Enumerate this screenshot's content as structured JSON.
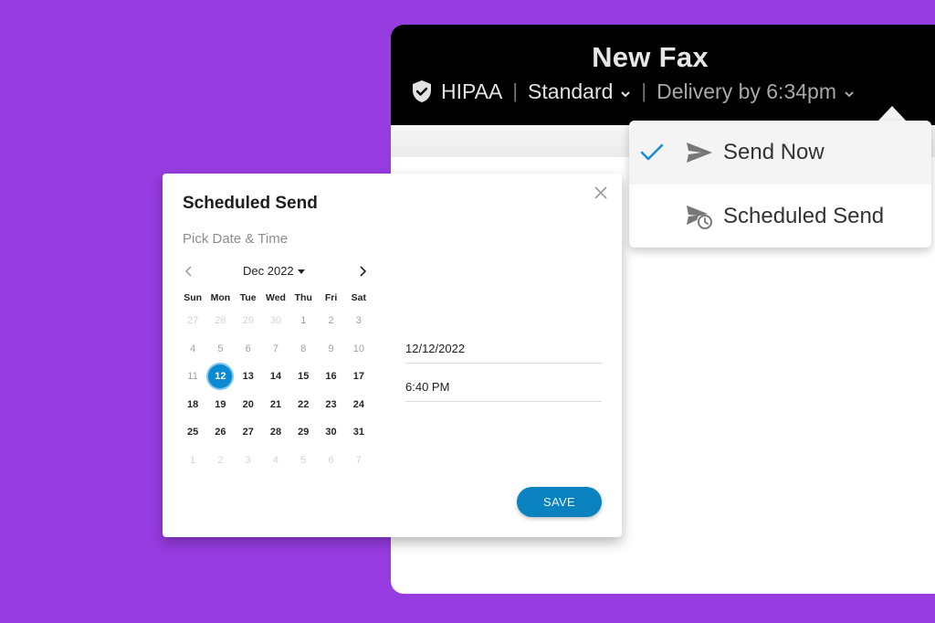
{
  "fax_window": {
    "title": "New Fax",
    "security_label": "HIPAA",
    "security_icon": "shield-check-icon",
    "quality_label": "Standard",
    "delivery_label": "Delivery by 6:34pm",
    "separator": "|"
  },
  "send_menu": {
    "items": [
      {
        "label": "Send Now",
        "icon": "paper-plane-icon",
        "checked": true
      },
      {
        "label": "Scheduled Send",
        "icon": "scheduled-send-icon",
        "checked": false
      }
    ]
  },
  "modal": {
    "title": "Scheduled Send",
    "subtitle": "Pick Date & Time",
    "date_value": "12/12/2022",
    "time_value": "6:40 PM",
    "save_label": "SAVE"
  },
  "calendar": {
    "month_label": "Dec 2022",
    "weekdays": [
      "Sun",
      "Mon",
      "Tue",
      "Wed",
      "Thu",
      "Fri",
      "Sat"
    ],
    "weeks": [
      [
        {
          "d": "27",
          "s": "other"
        },
        {
          "d": "28",
          "s": "other"
        },
        {
          "d": "29",
          "s": "other"
        },
        {
          "d": "30",
          "s": "other"
        },
        {
          "d": "1",
          "s": "past"
        },
        {
          "d": "2",
          "s": "past"
        },
        {
          "d": "3",
          "s": "past"
        }
      ],
      [
        {
          "d": "4",
          "s": "past"
        },
        {
          "d": "5",
          "s": "past"
        },
        {
          "d": "6",
          "s": "past"
        },
        {
          "d": "7",
          "s": "past"
        },
        {
          "d": "8",
          "s": "past"
        },
        {
          "d": "9",
          "s": "past"
        },
        {
          "d": "10",
          "s": "past"
        }
      ],
      [
        {
          "d": "11",
          "s": "past"
        },
        {
          "d": "12",
          "s": "selected"
        },
        {
          "d": "13",
          "s": "cur"
        },
        {
          "d": "14",
          "s": "cur"
        },
        {
          "d": "15",
          "s": "cur"
        },
        {
          "d": "16",
          "s": "cur"
        },
        {
          "d": "17",
          "s": "cur"
        }
      ],
      [
        {
          "d": "18",
          "s": "cur"
        },
        {
          "d": "19",
          "s": "cur"
        },
        {
          "d": "20",
          "s": "cur"
        },
        {
          "d": "21",
          "s": "cur"
        },
        {
          "d": "22",
          "s": "cur"
        },
        {
          "d": "23",
          "s": "cur"
        },
        {
          "d": "24",
          "s": "cur"
        }
      ],
      [
        {
          "d": "25",
          "s": "cur"
        },
        {
          "d": "26",
          "s": "cur"
        },
        {
          "d": "27",
          "s": "cur"
        },
        {
          "d": "28",
          "s": "cur"
        },
        {
          "d": "29",
          "s": "cur"
        },
        {
          "d": "30",
          "s": "cur"
        },
        {
          "d": "31",
          "s": "cur"
        }
      ],
      [
        {
          "d": "1",
          "s": "other"
        },
        {
          "d": "2",
          "s": "other"
        },
        {
          "d": "3",
          "s": "other"
        },
        {
          "d": "4",
          "s": "other"
        },
        {
          "d": "5",
          "s": "other"
        },
        {
          "d": "6",
          "s": "other"
        },
        {
          "d": "7",
          "s": "other"
        }
      ]
    ]
  },
  "colors": {
    "background": "#963ce0",
    "accent": "#0a82c0",
    "check": "#1a8fd6"
  }
}
